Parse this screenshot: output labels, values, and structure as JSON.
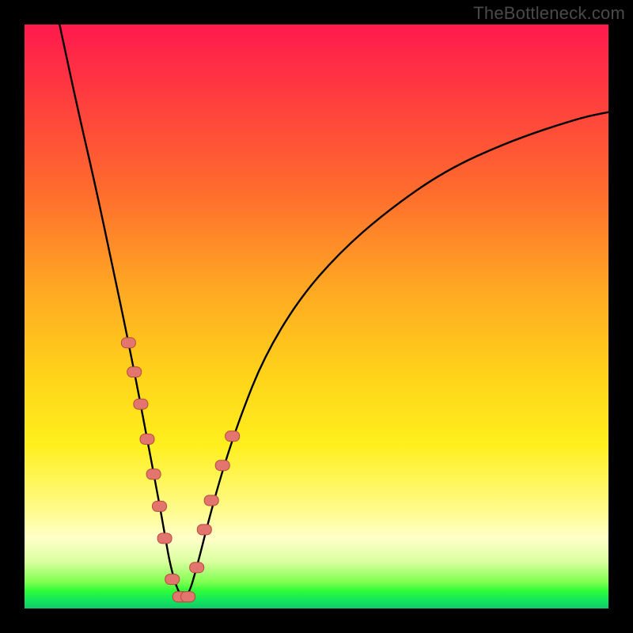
{
  "watermark": "TheBottleneck.com",
  "colors": {
    "frame": "#000000",
    "curve": "#000000",
    "marker_fill": "#e2766e",
    "marker_stroke": "#b7493e",
    "gradient_stops": [
      "#ff1a4d",
      "#ff3b3f",
      "#ff6a2e",
      "#ffa723",
      "#ffd31a",
      "#ffef1d",
      "#fffb8a",
      "#ffffc9",
      "#d9ff9f",
      "#7eff4e",
      "#2dfc3a",
      "#14e85a",
      "#0fc96a"
    ]
  },
  "chart_data": {
    "type": "line",
    "title": "",
    "xlabel": "",
    "ylabel": "",
    "x_range_pct": [
      0,
      100
    ],
    "y_range_pct": [
      0,
      100
    ],
    "note": "Values are percentages within the 738x738 plot area. y_pct measured from top.",
    "series": [
      {
        "name": "bottleneck-curve",
        "x_pct": [
          6.0,
          9.0,
          12.0,
          15.0,
          17.5,
          19.5,
          21.0,
          22.7,
          23.8,
          25.0,
          26.6,
          28.0,
          29.5,
          31.5,
          34.0,
          37.0,
          41.0,
          47.0,
          54.0,
          62.0,
          72.0,
          83.0,
          95.0,
          100.0
        ],
        "y_pct": [
          0.0,
          14.0,
          27.0,
          41.0,
          53.0,
          63.0,
          71.0,
          80.0,
          86.0,
          93.0,
          98.0,
          98.0,
          93.0,
          85.0,
          76.0,
          67.0,
          57.0,
          47.0,
          39.0,
          32.0,
          25.0,
          20.0,
          16.0,
          15.0
        ]
      }
    ],
    "markers": {
      "name": "highlighted-points",
      "shape": "rounded-capsule",
      "x_pct": [
        17.8,
        18.8,
        19.9,
        21.0,
        22.1,
        23.1,
        24.0,
        25.3,
        26.6,
        28.0,
        29.5,
        30.8,
        32.0,
        33.9,
        35.6
      ],
      "y_pct": [
        54.5,
        59.5,
        65.0,
        71.0,
        77.0,
        82.5,
        88.0,
        95.0,
        98.0,
        98.0,
        93.0,
        86.5,
        81.5,
        75.5,
        70.5
      ]
    }
  }
}
